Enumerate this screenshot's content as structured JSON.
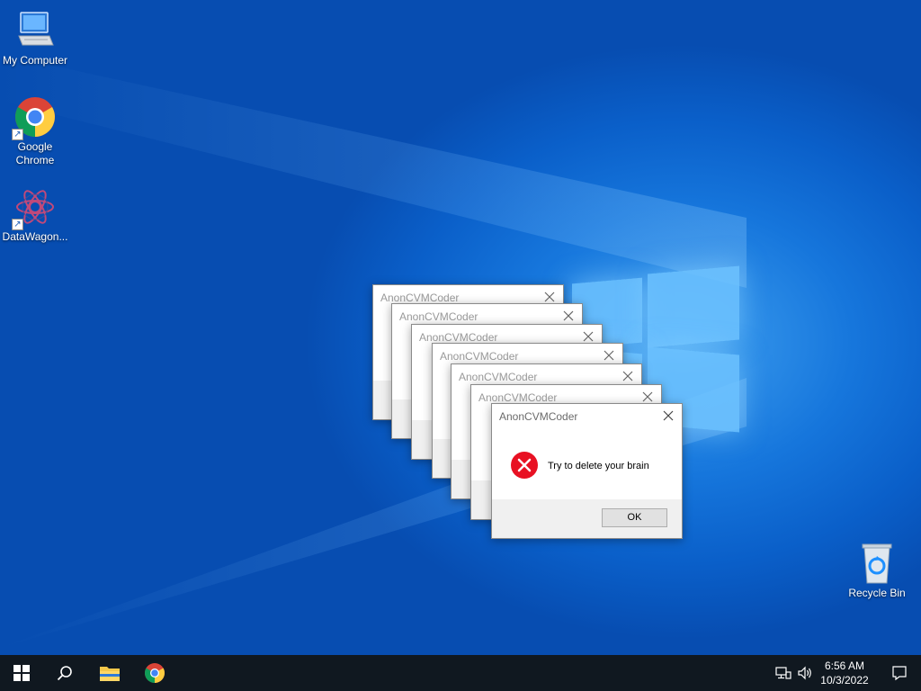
{
  "desktop": {
    "icons": [
      {
        "label": "My Computer",
        "icon": "monitor-icon"
      },
      {
        "label": "Google Chrome",
        "icon": "chrome-icon"
      },
      {
        "label": "DataWagon...",
        "icon": "datawagon-icon"
      },
      {
        "label": "Recycle Bin",
        "icon": "recycle-bin-icon"
      }
    ]
  },
  "dialogs": {
    "title": "AnonCVMCoder",
    "message": "Try to delete your brain",
    "ok_label": "OK",
    "icon": "error-icon",
    "count": 7
  },
  "taskbar": {
    "time": "6:56 AM",
    "date": "10/3/2022",
    "buttons": [
      "start-icon",
      "search-icon",
      "file-explorer-icon",
      "chrome-icon"
    ],
    "tray": [
      "network-icon",
      "volume-icon",
      "notification-icon"
    ]
  },
  "colors": {
    "desktop_blue": "#0a5fc9",
    "taskbar": "#101820",
    "error_red": "#e81123"
  }
}
